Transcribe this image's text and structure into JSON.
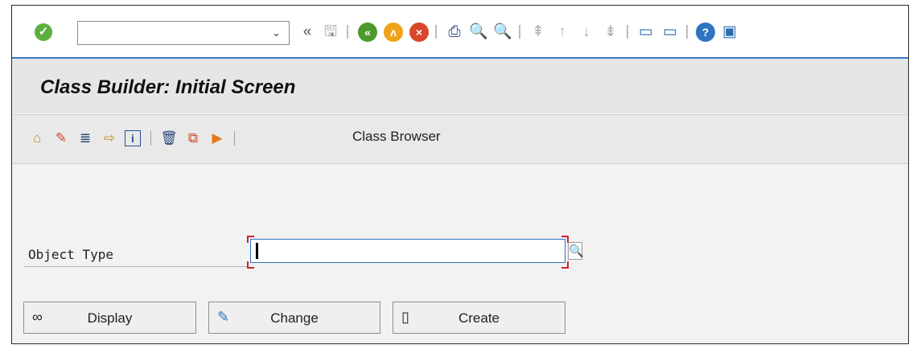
{
  "system_toolbar": {
    "command_field_value": "",
    "dropdown_glyph": "⌄",
    "icons": {
      "enter": "✓",
      "collapse": "«",
      "save": "🖫",
      "back": "«",
      "exit": "ʌ",
      "cancel": "×",
      "print": "⎙",
      "find": "🔍",
      "find_next": "🔍",
      "first_page": "⇞",
      "prev_page": "↑",
      "next_page": "↓",
      "last_page": "⇟",
      "new_session": "▭",
      "shortcut": "▭",
      "help": "?",
      "customize": "▣"
    }
  },
  "title": "Class Builder: Initial Screen",
  "app_toolbar": {
    "class_browser_label": "Class Browser",
    "icons": {
      "hierarchy": "⌂",
      "wizard": "✎",
      "object_list": "≣",
      "where_used": "⇨",
      "info": "i",
      "delete": "🗑",
      "copy": "⧉",
      "rename": "▶"
    }
  },
  "form": {
    "object_type_label": "Object Type",
    "object_type_value": "",
    "search_help_glyph": "🔍"
  },
  "buttons": {
    "display": {
      "label": "Display",
      "icon": "∞"
    },
    "change": {
      "label": "Change",
      "icon": "✎"
    },
    "create": {
      "label": "Create",
      "icon": "▯"
    }
  },
  "colors": {
    "accent_blue": "#3a7bbf",
    "ok_green": "#5cae3e",
    "back_green": "#4c9a2a",
    "exit_orange": "#f0a21a",
    "cancel_red": "#d9472b",
    "required_red": "#d0232a"
  }
}
